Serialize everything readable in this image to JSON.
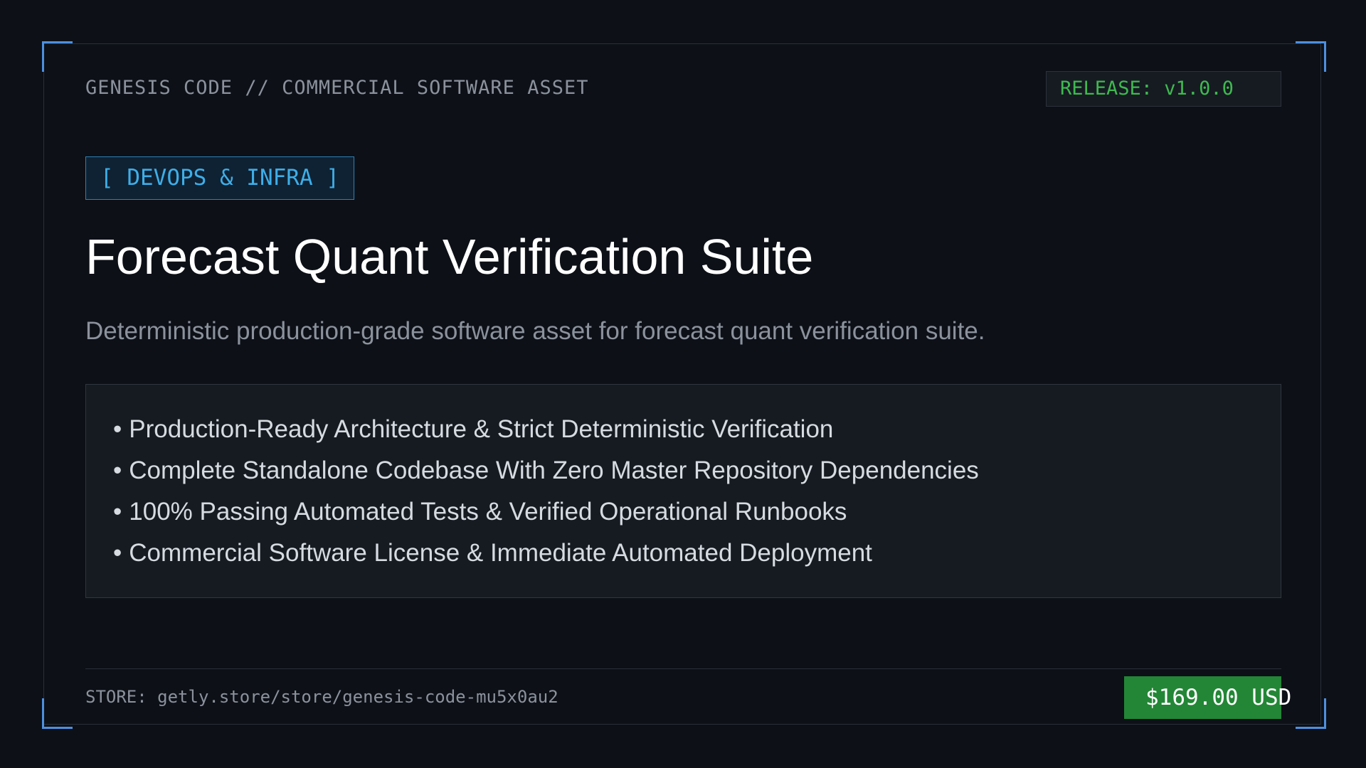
{
  "header": {
    "label": "GENESIS CODE // COMMERCIAL SOFTWARE ASSET",
    "release": "RELEASE: v1.0.0"
  },
  "category": "[ DEVOPS & INFRA ]",
  "title": "Forecast Quant Verification Suite",
  "subtitle": "Deterministic production-grade software asset for forecast quant verification suite.",
  "features": {
    "bullet": "•",
    "items": [
      "Production-Ready Architecture & Strict Deterministic Verification",
      "Complete Standalone Codebase With Zero Master Repository Dependencies",
      "100% Passing Automated Tests & Verified Operational Runbooks",
      "Commercial Software License & Immediate Automated Deployment"
    ]
  },
  "footer": {
    "store": "STORE: getly.store/store/genesis-code-mu5x0au2",
    "price": "$169.00 USD"
  },
  "colors": {
    "background": "#0d1017",
    "accent_blue": "#4d8fe0",
    "tag_blue": "#3eaee8",
    "release_green": "#3fb950",
    "price_green": "#238636"
  }
}
